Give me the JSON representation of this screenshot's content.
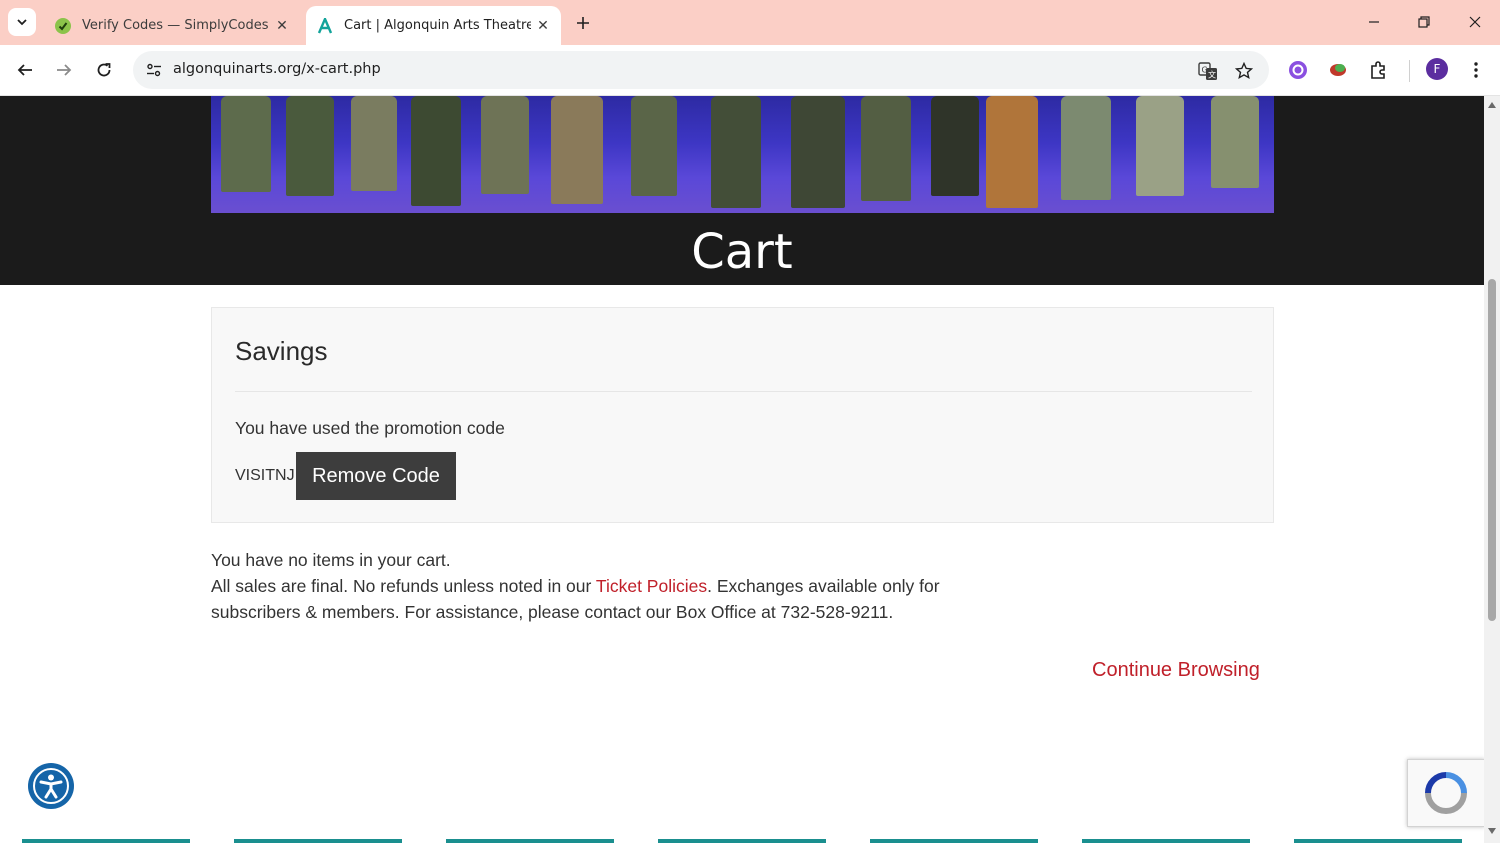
{
  "browser": {
    "tabs": [
      {
        "title": "Verify Codes — SimplyCodes",
        "active": false
      },
      {
        "title": "Cart | Algonquin Arts Theatre",
        "active": true
      }
    ],
    "url": "algonquinarts.org/x-cart.php",
    "profile_initial": "F"
  },
  "page": {
    "hero_title": "Cart",
    "savings": {
      "title": "Savings",
      "promo_text": "You have used the promotion code",
      "promo_code": "VISITNJ",
      "remove_label": "Remove Code"
    },
    "cart": {
      "empty_message": "You have no items in your cart.",
      "policy_before": "All sales are final. No refunds unless noted in our",
      "policy_link": "Ticket Policies",
      "policy_after": ". Exchanges available only for subscribers & members. For assistance, please contact our Box Office at 732-528-9211."
    },
    "continue_label": "Continue Browsing"
  },
  "colors": {
    "tabbar": "#fbcfc6",
    "link_red": "#c0202a",
    "hero_bg": "#1b1b1b",
    "button_dark": "#3d3d3d",
    "footer_teal": "#1a8f8f"
  },
  "icons": [
    "chevron-down-icon",
    "simplycodes-favicon",
    "algonquin-favicon",
    "close-icon",
    "plus-icon",
    "minimize-icon",
    "restore-icon",
    "back-icon",
    "forward-icon",
    "reload-icon",
    "site-info-icon",
    "translate-icon",
    "star-icon",
    "extension-icon",
    "kebab-menu-icon",
    "accessibility-icon",
    "recaptcha-icon"
  ]
}
